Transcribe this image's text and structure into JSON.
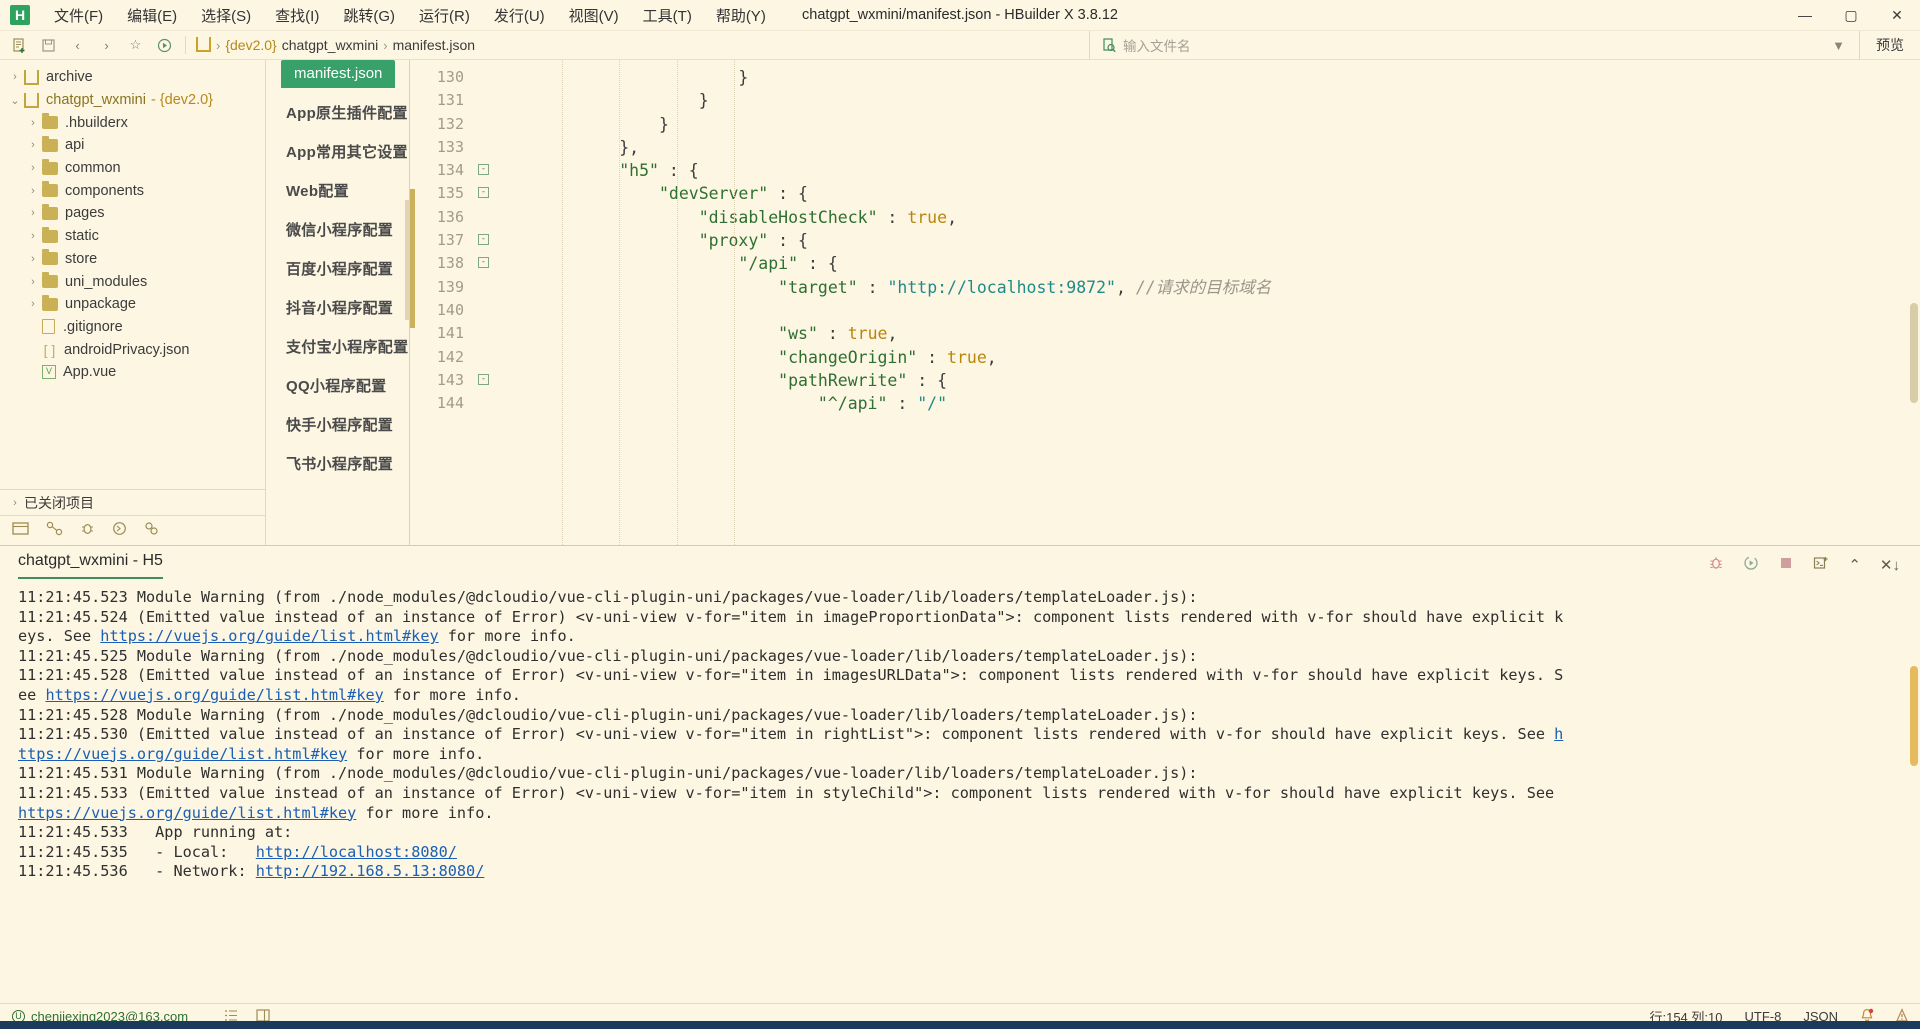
{
  "window": {
    "title": "chatgpt_wxmini/manifest.json - HBuilder X 3.8.12",
    "logo": "H",
    "minimize": "—",
    "maximize": "▢",
    "close": "✕"
  },
  "menubar": [
    {
      "label": "文件(F)"
    },
    {
      "label": "编辑(E)"
    },
    {
      "label": "选择(S)"
    },
    {
      "label": "查找(I)"
    },
    {
      "label": "跳转(G)"
    },
    {
      "label": "运行(R)"
    },
    {
      "label": "发行(U)"
    },
    {
      "label": "视图(V)"
    },
    {
      "label": "工具(T)"
    },
    {
      "label": "帮助(Y)"
    }
  ],
  "toolbar": {
    "icons": [
      "new-file-icon",
      "save-icon",
      "back-icon",
      "forward-icon",
      "star-icon",
      "run-icon"
    ],
    "breadcrumb": {
      "branch": "{dev2.0}",
      "project": "chatgpt_wxmini",
      "file": "manifest.json",
      "sep": "›"
    },
    "search_placeholder": "输入文件名",
    "filter_icon": "filter-icon",
    "preview_label": "预览"
  },
  "sidebar": {
    "tree": [
      {
        "indent": 1,
        "arrow": "›",
        "icon": "uni-project-icon",
        "label": "archive",
        "branch": ""
      },
      {
        "indent": 1,
        "arrow": "⌄",
        "icon": "uni-project-icon",
        "label": "chatgpt_wxmini",
        "branch": "- {dev2.0}"
      },
      {
        "indent": 2,
        "arrow": "›",
        "icon": "folder-icon",
        "label": ".hbuilderx",
        "branch": ""
      },
      {
        "indent": 2,
        "arrow": "›",
        "icon": "folder-icon",
        "label": "api",
        "branch": ""
      },
      {
        "indent": 2,
        "arrow": "›",
        "icon": "folder-icon",
        "label": "common",
        "branch": ""
      },
      {
        "indent": 2,
        "arrow": "›",
        "icon": "folder-icon",
        "label": "components",
        "branch": ""
      },
      {
        "indent": 2,
        "arrow": "›",
        "icon": "folder-icon",
        "label": "pages",
        "branch": ""
      },
      {
        "indent": 2,
        "arrow": "›",
        "icon": "folder-icon",
        "label": "static",
        "branch": ""
      },
      {
        "indent": 2,
        "arrow": "›",
        "icon": "folder-icon",
        "label": "store",
        "branch": ""
      },
      {
        "indent": 2,
        "arrow": "›",
        "icon": "folder-icon",
        "label": "uni_modules",
        "branch": ""
      },
      {
        "indent": 2,
        "arrow": "›",
        "icon": "folder-icon",
        "label": "unpackage",
        "branch": ""
      },
      {
        "indent": 2,
        "arrow": "",
        "icon": "file-icon",
        "label": ".gitignore",
        "branch": ""
      },
      {
        "indent": 2,
        "arrow": "",
        "icon": "json-file-icon",
        "label": "androidPrivacy.json",
        "branch": ""
      },
      {
        "indent": 2,
        "arrow": "",
        "icon": "vue-file-icon",
        "label": "App.vue",
        "branch": ""
      }
    ],
    "closed_projects": "已关闭项目",
    "tools": [
      "explorer-icon",
      "outline-icon",
      "debug-icon",
      "terminal-icon",
      "plugin-icon"
    ]
  },
  "manifest_nav": {
    "active_tab": "manifest.json",
    "items": [
      {
        "label": "App原生插件配置"
      },
      {
        "label": "App常用其它设置"
      },
      {
        "label": "Web配置"
      },
      {
        "label": "微信小程序配置"
      },
      {
        "label": "百度小程序配置"
      },
      {
        "label": "抖音小程序配置"
      },
      {
        "label": "支付宝小程序配置"
      },
      {
        "label": "QQ小程序配置"
      },
      {
        "label": "快手小程序配置"
      },
      {
        "label": "飞书小程序配置"
      }
    ]
  },
  "editor": {
    "lines": [
      {
        "no": "130",
        "fold": "",
        "indent": 24,
        "segs": [
          {
            "t": "}",
            "c": "p"
          }
        ]
      },
      {
        "no": "131",
        "fold": "",
        "indent": 20,
        "segs": [
          {
            "t": "}",
            "c": "p"
          }
        ]
      },
      {
        "no": "132",
        "fold": "",
        "indent": 16,
        "segs": [
          {
            "t": "}",
            "c": "p"
          }
        ]
      },
      {
        "no": "133",
        "fold": "",
        "indent": 12,
        "segs": [
          {
            "t": "},",
            "c": "p"
          }
        ]
      },
      {
        "no": "134",
        "fold": "⊟",
        "indent": 12,
        "segs": [
          {
            "t": "\"h5\"",
            "c": "k"
          },
          {
            "t": " : {",
            "c": "p"
          }
        ]
      },
      {
        "no": "135",
        "fold": "⊟",
        "indent": 16,
        "segs": [
          {
            "t": "\"devServer\"",
            "c": "k"
          },
          {
            "t": " : {",
            "c": "p"
          }
        ]
      },
      {
        "no": "136",
        "fold": "",
        "indent": 20,
        "segs": [
          {
            "t": "\"disableHostCheck\"",
            "c": "k"
          },
          {
            "t": " : ",
            "c": "p"
          },
          {
            "t": "true",
            "c": "v-bool"
          },
          {
            "t": ",",
            "c": "p"
          }
        ]
      },
      {
        "no": "137",
        "fold": "⊟",
        "indent": 20,
        "segs": [
          {
            "t": "\"proxy\"",
            "c": "k"
          },
          {
            "t": " : {",
            "c": "p"
          }
        ]
      },
      {
        "no": "138",
        "fold": "⊟",
        "indent": 24,
        "segs": [
          {
            "t": "\"/api\"",
            "c": "k"
          },
          {
            "t": " : {",
            "c": "p"
          }
        ]
      },
      {
        "no": "139",
        "fold": "",
        "indent": 28,
        "segs": [
          {
            "t": "\"target\"",
            "c": "k"
          },
          {
            "t": " : ",
            "c": "p"
          },
          {
            "t": "\"http://localhost:9872\"",
            "c": "v-str"
          },
          {
            "t": ", ",
            "c": "p"
          },
          {
            "t": "//请求的目标域名",
            "c": "cmt"
          }
        ]
      },
      {
        "no": "140",
        "fold": "",
        "indent": 0,
        "segs": []
      },
      {
        "no": "141",
        "fold": "",
        "indent": 28,
        "segs": [
          {
            "t": "\"ws\"",
            "c": "k"
          },
          {
            "t": " : ",
            "c": "p"
          },
          {
            "t": "true",
            "c": "v-bool"
          },
          {
            "t": ",",
            "c": "p"
          }
        ]
      },
      {
        "no": "142",
        "fold": "",
        "indent": 28,
        "segs": [
          {
            "t": "\"changeOrigin\"",
            "c": "k"
          },
          {
            "t": " : ",
            "c": "p"
          },
          {
            "t": "true",
            "c": "v-bool"
          },
          {
            "t": ",",
            "c": "p"
          }
        ]
      },
      {
        "no": "143",
        "fold": "⊟",
        "indent": 28,
        "segs": [
          {
            "t": "\"pathRewrite\"",
            "c": "k"
          },
          {
            "t": " : {",
            "c": "p"
          }
        ]
      },
      {
        "no": "144",
        "fold": "",
        "indent": 32,
        "segs": [
          {
            "t": "\"^/api\"",
            "c": "k"
          },
          {
            "t": " : ",
            "c": "p"
          },
          {
            "t": "\"/\"",
            "c": "v-str"
          }
        ]
      }
    ]
  },
  "console": {
    "tab_label": "chatgpt_wxmini - H5",
    "actions": [
      "bug-icon",
      "rerun-icon",
      "stop-icon",
      "new-terminal-icon",
      "collapse-icon",
      "clear-icon"
    ],
    "lines": [
      {
        "parts": [
          {
            "t": "11:21:45.523 Module Warning (from ./node_modules/@dcloudio/vue-cli-plugin-uni/packages/vue-loader/lib/loaders/templateLoader.js):",
            "c": ""
          }
        ]
      },
      {
        "parts": [
          {
            "t": "11:21:45.524 (Emitted value instead of an instance of Error) <v-uni-view v-for=\"item in imageProportionData\">: component lists rendered with v-for should have explicit k",
            "c": ""
          }
        ]
      },
      {
        "parts": [
          {
            "t": "eys. See ",
            "c": ""
          },
          {
            "t": "https://vuejs.org/guide/list.html#key",
            "c": "lnk"
          },
          {
            "t": " for more info.",
            "c": ""
          }
        ]
      },
      {
        "parts": [
          {
            "t": "11:21:45.525 Module Warning (from ./node_modules/@dcloudio/vue-cli-plugin-uni/packages/vue-loader/lib/loaders/templateLoader.js):",
            "c": ""
          }
        ]
      },
      {
        "parts": [
          {
            "t": "11:21:45.528 (Emitted value instead of an instance of Error) <v-uni-view v-for=\"item in imagesURLData\">: component lists rendered with v-for should have explicit keys. S",
            "c": ""
          }
        ]
      },
      {
        "parts": [
          {
            "t": "ee ",
            "c": ""
          },
          {
            "t": "https://vuejs.org/guide/list.html#key",
            "c": "lnk"
          },
          {
            "t": " for more info.",
            "c": ""
          }
        ]
      },
      {
        "parts": [
          {
            "t": "11:21:45.528 Module Warning (from ./node_modules/@dcloudio/vue-cli-plugin-uni/packages/vue-loader/lib/loaders/templateLoader.js):",
            "c": ""
          }
        ]
      },
      {
        "parts": [
          {
            "t": "11:21:45.530 (Emitted value instead of an instance of Error) <v-uni-view v-for=\"item in rightList\">: component lists rendered with v-for should have explicit keys. See ",
            "c": ""
          },
          {
            "t": "h",
            "c": "lnk"
          }
        ]
      },
      {
        "parts": [
          {
            "t": "ttps://vuejs.org/guide/list.html#key",
            "c": "lnk"
          },
          {
            "t": " for more info.",
            "c": ""
          }
        ]
      },
      {
        "parts": [
          {
            "t": "11:21:45.531 Module Warning (from ./node_modules/@dcloudio/vue-cli-plugin-uni/packages/vue-loader/lib/loaders/templateLoader.js):",
            "c": ""
          }
        ]
      },
      {
        "parts": [
          {
            "t": "11:21:45.533 (Emitted value instead of an instance of Error) <v-uni-view v-for=\"item in styleChild\">: component lists rendered with v-for should have explicit keys. See",
            "c": ""
          }
        ]
      },
      {
        "parts": [
          {
            "t": "https://vuejs.org/guide/list.html#key",
            "c": "lnk"
          },
          {
            "t": " for more info.",
            "c": ""
          }
        ]
      },
      {
        "parts": [
          {
            "t": "11:21:45.533   App running at:",
            "c": ""
          }
        ]
      },
      {
        "parts": [
          {
            "t": "11:21:45.535   - Local:   ",
            "c": ""
          },
          {
            "t": "http://localhost:8080/",
            "c": "lnk"
          }
        ]
      },
      {
        "parts": [
          {
            "t": "11:21:45.536   - Network: ",
            "c": ""
          },
          {
            "t": "http://192.168.5.13:8080/",
            "c": "lnk"
          }
        ]
      }
    ]
  },
  "statusbar": {
    "account": "chenjiexing2023@163.com",
    "account_icon": "account-icon",
    "mid_icons": [
      "list-icon",
      "layout-icon"
    ],
    "position": "行:154 列:10",
    "encoding": "UTF-8",
    "language": "JSON",
    "notify_icon": "bell-icon",
    "alert_icon": "alert-icon"
  },
  "colors": {
    "bg": "#fdf6e3",
    "accent_green": "#38a169",
    "branch_gold": "#b5891b",
    "link_blue": "#1a5fb4"
  }
}
